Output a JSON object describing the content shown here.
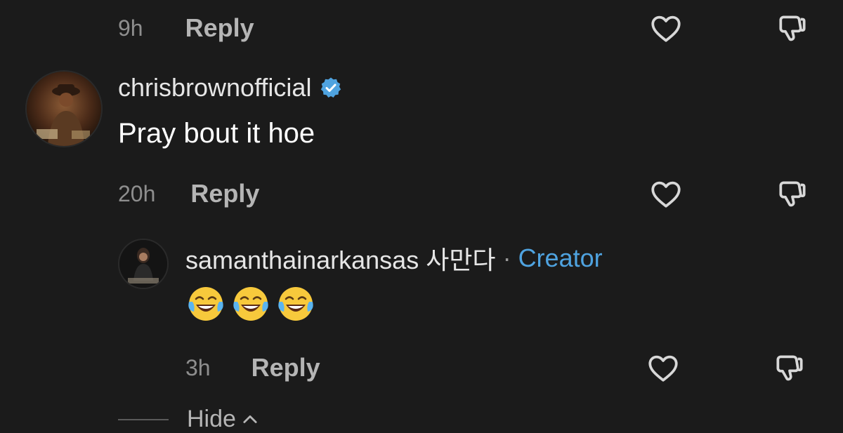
{
  "comments": [
    {
      "time": "9h",
      "reply_label": "Reply"
    },
    {
      "username": "chrisbrownofficial",
      "verified": true,
      "text": "Pray bout it hoe",
      "time": "20h",
      "reply_label": "Reply"
    },
    {
      "username": "samanthainarkansas 사만다",
      "separator": "·",
      "role_badge": "Creator",
      "emoji": [
        "face-with-tears-of-joy",
        "face-with-tears-of-joy",
        "face-with-tears-of-joy"
      ],
      "time": "3h",
      "reply_label": "Reply"
    }
  ],
  "replies": {
    "hide_label": "Hide"
  },
  "colors": {
    "background": "#1b1b1b",
    "creator_accent": "#4fa3e0",
    "verified_badge": "#4fa3e0"
  }
}
